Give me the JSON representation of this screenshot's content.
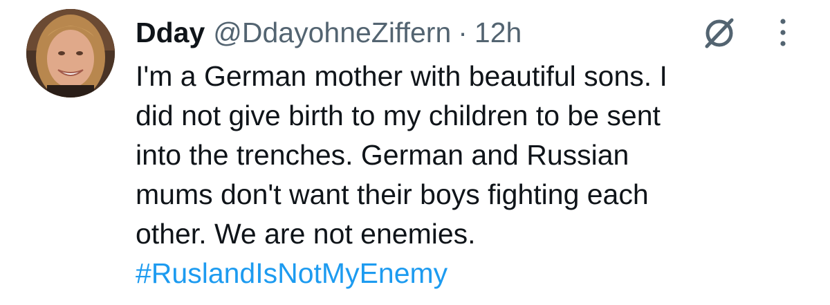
{
  "tweet": {
    "display_name": "Dday",
    "handle": "@DdayohneZiffern",
    "separator": "·",
    "time": "12h",
    "text": "I'm a German mother with beautiful sons. I\ndid not give birth to my children to be sent\ninto the trenches. German and Russian\nmums don't want their boys fighting each\nother. We are not enemies.",
    "hashtag": "#RuslandIsNotMyEnemy"
  },
  "icons": {
    "avatar": "avatar-photo",
    "grok": "grok-icon",
    "more": "more-vertical-icon"
  },
  "colors": {
    "text": "#0f1419",
    "secondary": "#536471",
    "link": "#1d9bf0",
    "background": "#ffffff"
  }
}
